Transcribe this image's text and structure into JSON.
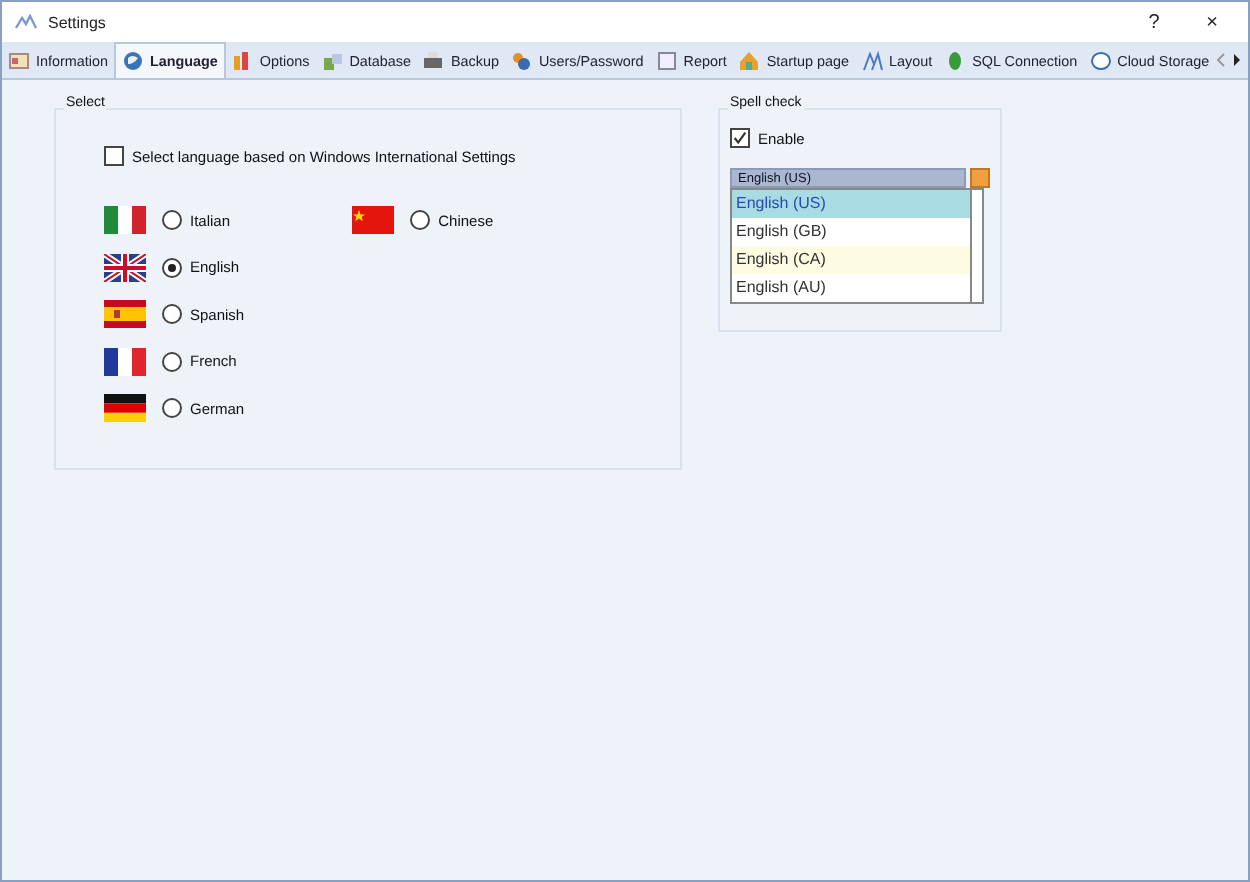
{
  "window": {
    "title": "Settings",
    "help": "?",
    "close": "×"
  },
  "tabs": [
    {
      "label": "Information",
      "selected": false
    },
    {
      "label": "Language",
      "selected": true
    },
    {
      "label": "Options",
      "selected": false
    },
    {
      "label": "Database",
      "selected": false
    },
    {
      "label": "Backup",
      "selected": false
    },
    {
      "label": "Users/Password",
      "selected": false
    },
    {
      "label": "Report",
      "selected": false
    },
    {
      "label": "Startup page",
      "selected": false
    },
    {
      "label": "Layout",
      "selected": false
    },
    {
      "label": "SQL Connection",
      "selected": false
    },
    {
      "label": "Cloud Storage",
      "selected": false
    }
  ],
  "select_group": {
    "title": "Select",
    "windows_settings": {
      "label": "Select language based on Windows International Settings",
      "checked": false
    },
    "columns": [
      [
        {
          "label": "Italian",
          "selected": false
        },
        {
          "label": "English",
          "selected": true
        },
        {
          "label": "Spanish",
          "selected": false
        },
        {
          "label": "French",
          "selected": false
        },
        {
          "label": "German",
          "selected": false
        }
      ],
      [
        {
          "label": "Chinese",
          "selected": false
        }
      ]
    ]
  },
  "spell_check": {
    "title": "Spell check",
    "enable": {
      "label": "Enable",
      "checked": true
    },
    "dropdown": {
      "value": "English (US)"
    },
    "options": [
      {
        "label": "English (US)",
        "selected": true,
        "hovered": false
      },
      {
        "label": "English (GB)",
        "selected": false,
        "hovered": false
      },
      {
        "label": "English (CA)",
        "selected": false,
        "hovered": true
      },
      {
        "label": "English (AU)",
        "selected": false,
        "hovered": false
      }
    ]
  }
}
